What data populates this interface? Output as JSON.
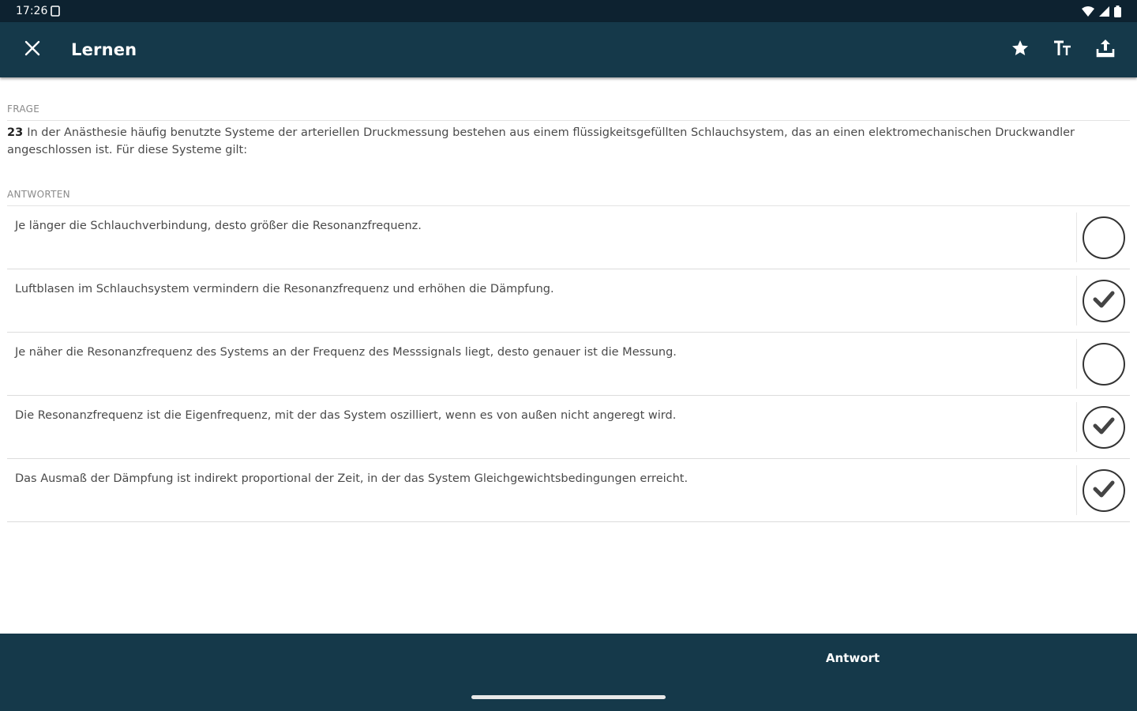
{
  "status_bar": {
    "time": "17:26"
  },
  "app_bar": {
    "title": "Lernen"
  },
  "question": {
    "section_label": "FRAGE",
    "number": "23",
    "text": "In der Anästhesie häufig benutzte Systeme der arteriellen Druckmessung bestehen aus einem flüssigkeitsgefüllten Schlauchsystem, das an einen elektromechanischen Druckwandler angeschlossen ist. Für diese Systeme gilt:"
  },
  "answers": {
    "section_label": "ANTWORTEN",
    "items": [
      {
        "text": "Je länger die Schlauchverbindung, desto größer die Resonanzfrequenz.",
        "checked": false
      },
      {
        "text": "Luftblasen im Schlauchsystem vermindern die Resonanzfrequenz und erhöhen die Dämpfung.",
        "checked": true
      },
      {
        "text": "Je näher die Resonanzfrequenz des Systems an der Frequenz des Messsignals liegt, desto genauer ist die Messung.",
        "checked": false
      },
      {
        "text": "Die Resonanzfrequenz ist die Eigenfrequenz, mit der das System oszilliert, wenn es von außen nicht angeregt wird.",
        "checked": true
      },
      {
        "text": "Das Ausmaß der Dämpfung ist indirekt proportional der Zeit, in der das System Gleichgewichtsbedingungen erreicht.",
        "checked": true
      }
    ]
  },
  "bottom_bar": {
    "answer_label": "Antwort"
  },
  "icons": {
    "close": "close-icon",
    "favorite": "star-icon",
    "font_size": "text-size-icon",
    "share": "share-icon",
    "check": "check-icon"
  },
  "colors": {
    "app_bar": "#15394a",
    "status_bar": "#0d2230",
    "background": "#ffffff"
  }
}
